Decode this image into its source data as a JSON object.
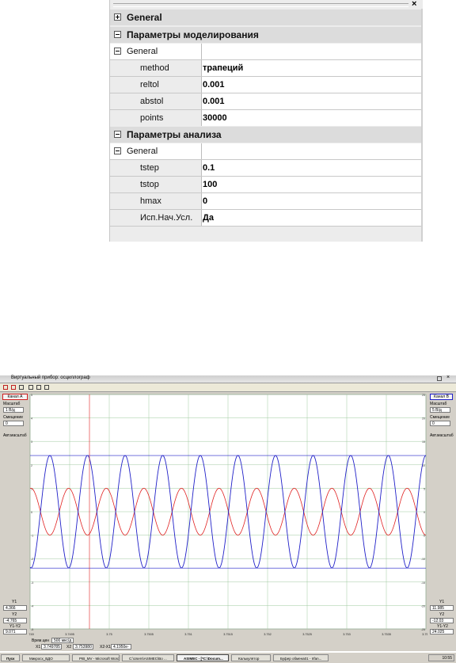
{
  "property_panel": {
    "close_symbol": "×",
    "sections": [
      {
        "label": "General",
        "expanded": false
      },
      {
        "label": "Параметры моделирования",
        "expanded": true,
        "group": "General",
        "props": [
          {
            "name": "method",
            "value": "трапеций"
          },
          {
            "name": "reltol",
            "value": "0.001"
          },
          {
            "name": "abstol",
            "value": "0.001"
          },
          {
            "name": "points",
            "value": "30000"
          }
        ]
      },
      {
        "label": "Параметры анализа",
        "expanded": true,
        "group": "General",
        "props": [
          {
            "name": "tstep",
            "value": "0.1"
          },
          {
            "name": "tstop",
            "value": "100"
          },
          {
            "name": "hmax",
            "value": "0"
          },
          {
            "name": "Исп.Нач.Усл.",
            "value": "Да"
          }
        ]
      }
    ]
  },
  "oscilloscope": {
    "title": "Виртуальный прибор: осциллограф",
    "left": {
      "channel": "Канал А",
      "scale_label": "Масштаб",
      "scale_value": "1 В/д",
      "offset_label": "Смещение",
      "offset_value": "0",
      "auto_label": "Авт.масштаб",
      "y1_label": "Y1",
      "y1_value": "4.366",
      "y2_label": "Y2",
      "y2_value": "-4.765",
      "dy_label": "Y1-Y2",
      "dy_value": "9.071",
      "ticks": [
        "5",
        "4",
        "3",
        "2",
        "1",
        "0",
        "-1",
        "-2",
        "-3",
        "-4",
        "-5"
      ]
    },
    "right": {
      "channel": "Канал В",
      "scale_label": "Масштаб",
      "scale_value": "5 В/д",
      "offset_label": "Смещение",
      "offset_value": "0",
      "auto_label": "Авт.масштаб",
      "y1_label": "Y1",
      "y1_value": "11.985",
      "y2_label": "Y2",
      "y2_value": "-12.03",
      "dy_label": "Y1-Y2",
      "dy_value": "24.025",
      "ticks": [
        "25",
        "20",
        "15",
        "10",
        "5",
        "0",
        "-5",
        "-10",
        "-15",
        "-20",
        "-25"
      ]
    },
    "x_ticks": [
      "3.749",
      "3.7495",
      "3.75",
      "3.7505",
      "3.751",
      "3.7515",
      "3.752",
      "3.7525",
      "3.753",
      "3.7535",
      "3.754"
    ],
    "bottom": {
      "time_label": "Врем.цен",
      "time_value": "500 мкс/д",
      "x1_label": "X1",
      "x1_value": "3.749785",
      "x2_label": "X2",
      "x2_value": "3.753980",
      "dx_label": "X2-X1",
      "dx_value": "4.1950e-"
    },
    "colors": {
      "channel_a": "#e02020",
      "channel_b": "#2020c8",
      "grid": "#9fc99f",
      "cursor_y": "#2020c8"
    }
  },
  "taskbar": {
    "start": "Пуск",
    "items": [
      "Микросх_ВДО",
      "PIB_MV - Microsoft Word",
      "C:\\Users\\ASIMEC\\Bo ...",
      "ASIMEC - [*C:\\Docum...",
      "Калькулятор",
      "Буфер обмена01 - Irfan..."
    ],
    "clock": "10:55"
  }
}
